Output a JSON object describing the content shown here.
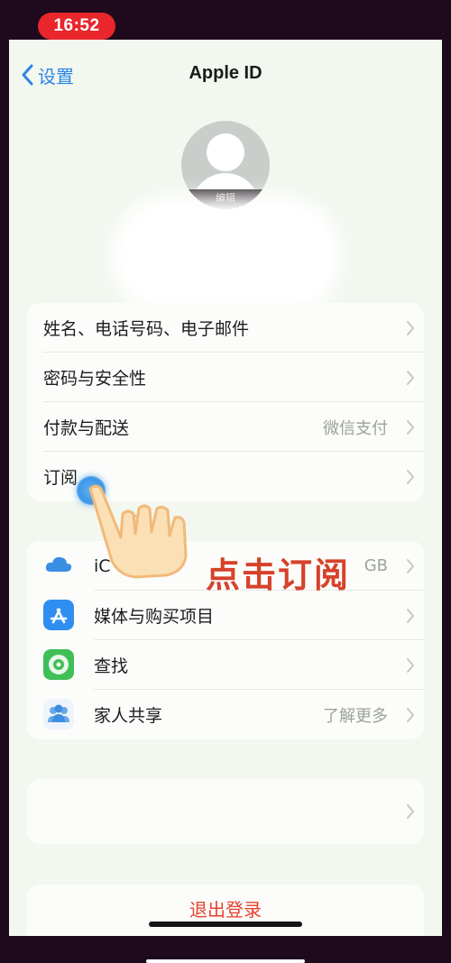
{
  "status_bar": {
    "time": "16:52"
  },
  "nav": {
    "back_label": "设置",
    "title": "Apple ID"
  },
  "profile": {
    "edit_label": "编辑"
  },
  "account_group": [
    {
      "label": "姓名、电话号码、电子邮件",
      "value": ""
    },
    {
      "label": "密码与安全性",
      "value": ""
    },
    {
      "label": "付款与配送",
      "value": "微信支付"
    },
    {
      "label": "订阅",
      "value": ""
    }
  ],
  "services_group": [
    {
      "label": "iC",
      "value": "GB",
      "icon": "icloud-icon"
    },
    {
      "label": "媒体与购买项目",
      "value": "",
      "icon": "app-store-icon"
    },
    {
      "label": "查找",
      "value": "",
      "icon": "find-my-icon"
    },
    {
      "label": "家人共享",
      "value": "了解更多",
      "icon": "family-sharing-icon"
    }
  ],
  "device_group": {
    "label": ""
  },
  "logout": {
    "label": "退出登录"
  },
  "annotation": {
    "text": "点击订阅",
    "pointer_icon": "tap-hand-icon"
  },
  "colors": {
    "accent": "#2d86e6",
    "destructive": "#e8402f",
    "annotation": "#d6422a",
    "time_pill": "#e8262c"
  }
}
